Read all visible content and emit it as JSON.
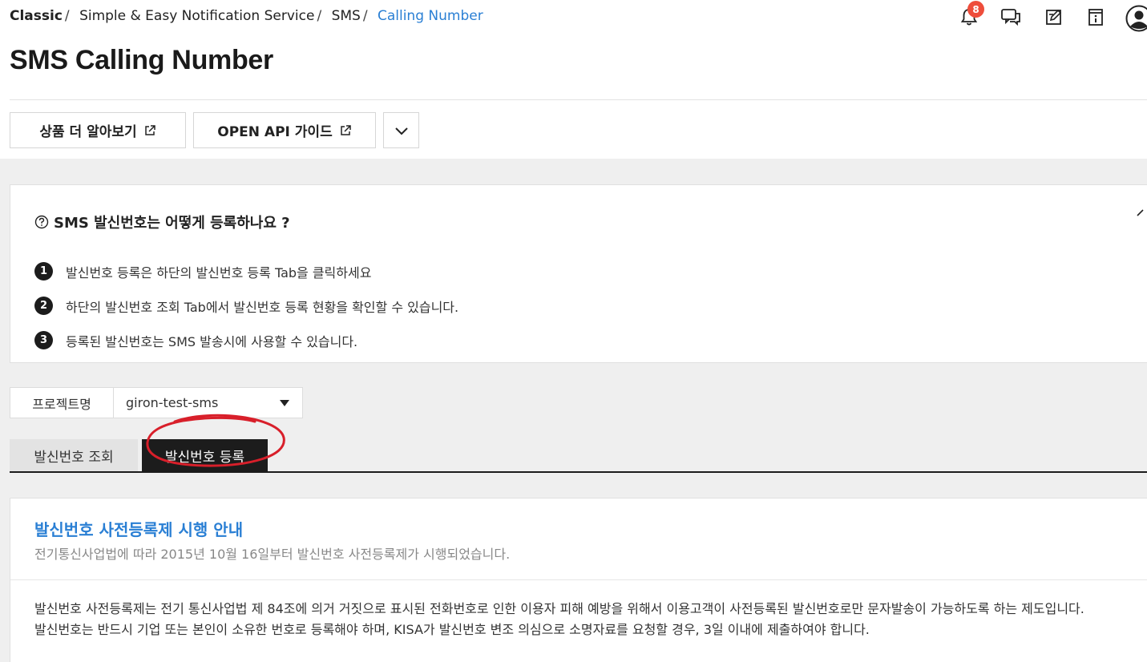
{
  "breadcrumb": {
    "root": "Classic",
    "items": [
      "Simple & Easy Notification Service",
      "SMS"
    ],
    "current": "Calling Number"
  },
  "notifications": {
    "count": "8"
  },
  "top_icons": [
    "bell-icon",
    "chat-icon",
    "edit-note-icon",
    "info-book-icon",
    "user-avatar-icon"
  ],
  "page": {
    "title": "SMS Calling Number"
  },
  "header_buttons": {
    "learn_more": "상품 더 알아보기",
    "api_guide": "OPEN API 가이드"
  },
  "help": {
    "title": "SMS 발신번호는 어떻게 등록하나요 ?",
    "steps": [
      {
        "num": "1",
        "text": "발신번호 등록은 하단의 발신번호 등록 Tab을 클릭하세요"
      },
      {
        "num": "2",
        "text": "하단의 발신번호 조회 Tab에서 발신번호 등록 현황을 확인할 수 있습니다."
      },
      {
        "num": "3",
        "text": "등록된 발신번호는 SMS 발송시에 사용할 수 있습니다."
      }
    ]
  },
  "project": {
    "label": "프로젝트명",
    "selected": "giron-test-sms"
  },
  "tabs": {
    "inquiry": "발신번호 조회",
    "register": "발신번호 등록",
    "active": "register"
  },
  "notice": {
    "title": "발신번호 사전등록제 시행 안내",
    "subtitle": "전기통신사업법에 따라 2015년 10월 16일부터 발신번호 사전등록제가 시행되었습니다.",
    "paragraph1": "발신번호 사전등록제는 전기 통신사업법 제 84조에 의거 거짓으로 표시된 전화번호로 인한 이용자 피해 예방을 위해서 이용고객이 사전등록된 발신번호로만 문자발송이 가능하도록 하는 제도입니다.",
    "paragraph2": "발신번호는 반드시 기업 또는 본인이 소유한 번호로 등록해야 하며, KISA가 발신번호 변조 의심으로 소명자료를 요청할 경우, 3일 이내에 제출하여야 합니다."
  },
  "colors": {
    "link_blue": "#2a7fd4",
    "badge_red": "#ee4d3b",
    "annotation_red": "#d81f2a",
    "dark": "#1c1c1c"
  }
}
